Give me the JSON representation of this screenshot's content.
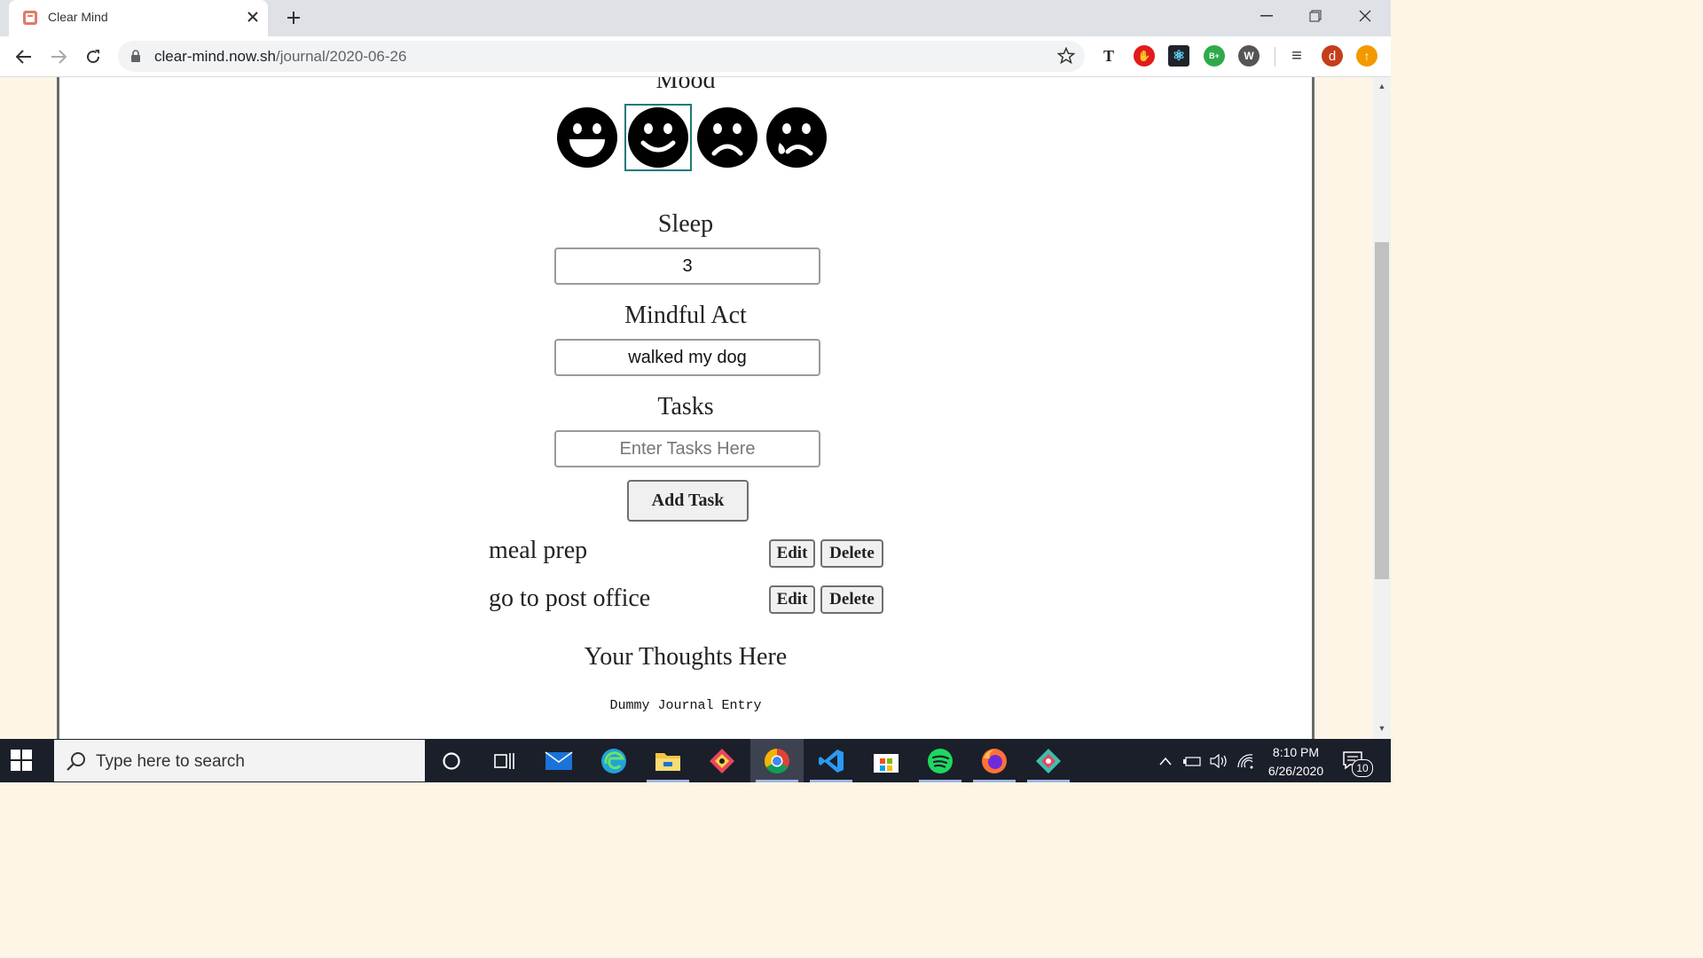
{
  "browser": {
    "tab_title": "Clear Mind",
    "url_host": "clear-mind.now.sh",
    "url_path": "/journal/2020-06-26",
    "extensions": [
      {
        "name": "text-extension-icon",
        "glyph": "T"
      },
      {
        "name": "stop-extension-icon",
        "glyph": "✋"
      },
      {
        "name": "react-devtools-icon",
        "glyph": "⚛"
      },
      {
        "name": "bplus-extension-icon",
        "glyph": "B+"
      },
      {
        "name": "w-extension-icon",
        "glyph": "W"
      },
      {
        "name": "media-control-icon",
        "glyph": "≡"
      },
      {
        "name": "profile-avatar",
        "glyph": "d"
      },
      {
        "name": "update-icon",
        "glyph": "↑"
      }
    ]
  },
  "journal": {
    "mood_label": "Mood",
    "moods": [
      {
        "name": "very-happy-face-icon",
        "selected": false
      },
      {
        "name": "happy-face-icon",
        "selected": true
      },
      {
        "name": "sad-face-icon",
        "selected": false
      },
      {
        "name": "crying-face-icon",
        "selected": false
      }
    ],
    "sleep_label": "Sleep",
    "sleep_value": "3",
    "mindful_label": "Mindful Act",
    "mindful_value": "walked my dog",
    "tasks_label": "Tasks",
    "tasks_placeholder": "Enter Tasks Here",
    "add_task_label": "Add Task",
    "tasks": [
      {
        "text": "meal prep",
        "edit": "Edit",
        "delete": "Delete"
      },
      {
        "text": "go to post office",
        "edit": "Edit",
        "delete": "Delete"
      }
    ],
    "thoughts_label": "Your Thoughts Here",
    "entry_text": "Dummy Journal Entry"
  },
  "taskbar": {
    "search_placeholder": "Type here to search",
    "time": "8:10 PM",
    "date": "6/26/2020",
    "notification_count": "10"
  },
  "colors": {
    "accent_selected": "#1f7a78",
    "page_bg": "#fdf6e6",
    "taskbar_bg": "#1b1f2a"
  }
}
